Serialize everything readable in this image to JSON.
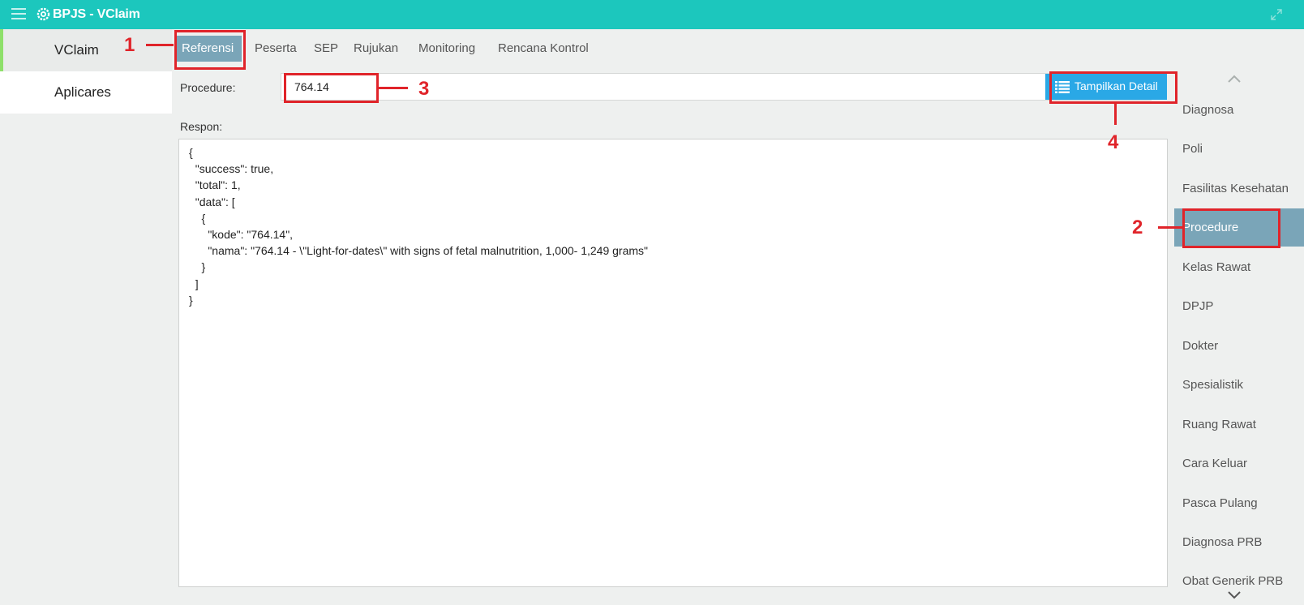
{
  "titlebar": {
    "title": "BPJS - VClaim",
    "menu_icon": "hamburger-icon",
    "logo_icon": "gear-icon",
    "expand_icon": "expand-icon",
    "color": "#1cc7bd"
  },
  "left_nav": {
    "items": [
      {
        "label": "VClaim",
        "active": true
      },
      {
        "label": "Aplicares",
        "active": false
      }
    ],
    "active_indicator_color": "#8ee06a"
  },
  "tabs": [
    {
      "label": "Referensi",
      "active": true
    },
    {
      "label": "Peserta",
      "active": false
    },
    {
      "label": "SEP",
      "active": false
    },
    {
      "label": "Rujukan",
      "active": false
    },
    {
      "label": "Monitoring",
      "active": false
    },
    {
      "label": "Rencana Kontrol",
      "active": false
    }
  ],
  "form": {
    "procedure_label": "Procedure:",
    "procedure_value": "764.14",
    "button_label": "Tampilkan Detail",
    "button_icon": "list-icon",
    "button_color": "#2aa8e6",
    "respon_label": "Respon:"
  },
  "response_lines": [
    "{",
    "  \"success\": true,",
    "  \"total\": 1,",
    "  \"data\": [",
    "    {",
    "      \"kode\": \"764.14\",",
    "      \"nama\": \"764.14 - \\\"Light-for-dates\\\" with signs of fetal malnutrition, 1,000- 1,249 grams\"",
    "    }",
    "  ]",
    "}"
  ],
  "reference_menu": {
    "items": [
      {
        "label": "Diagnosa",
        "active": false
      },
      {
        "label": "Poli",
        "active": false
      },
      {
        "label": "Fasilitas Kesehatan",
        "active": false
      },
      {
        "label": "Procedure",
        "active": true
      },
      {
        "label": "Kelas Rawat",
        "active": false
      },
      {
        "label": "DPJP",
        "active": false
      },
      {
        "label": "Dokter",
        "active": false
      },
      {
        "label": "Spesialistik",
        "active": false
      },
      {
        "label": "Ruang Rawat",
        "active": false
      },
      {
        "label": "Cara Keluar",
        "active": false
      },
      {
        "label": "Pasca Pulang",
        "active": false
      },
      {
        "label": "Diagnosa PRB",
        "active": false
      },
      {
        "label": "Obat Generik PRB",
        "active": false
      }
    ],
    "active_color": "#7aa5b8",
    "scroll_up_icon": "chevron-up-icon",
    "scroll_down_icon": "chevron-down-icon"
  },
  "annotations": [
    {
      "number": "1",
      "target": "tab-referensi"
    },
    {
      "number": "2",
      "target": "ref-item-procedure"
    },
    {
      "number": "3",
      "target": "procedure-input"
    },
    {
      "number": "4",
      "target": "tampilkan-detail-button"
    }
  ],
  "annotation_color": "#e0242a"
}
